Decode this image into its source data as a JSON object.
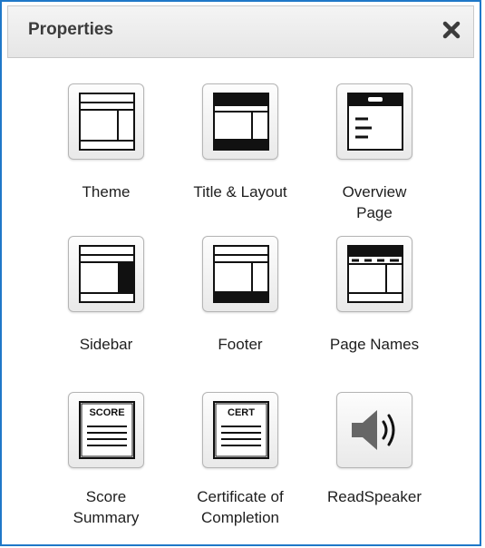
{
  "panel": {
    "title": "Properties",
    "close_icon": "close-icon"
  },
  "tiles": [
    {
      "label": "Theme",
      "icon": "theme-icon"
    },
    {
      "label": "Title & Layout",
      "icon": "title-layout-icon"
    },
    {
      "label": "Overview\nPage",
      "icon": "overview-page-icon"
    },
    {
      "label": "Sidebar",
      "icon": "sidebar-icon"
    },
    {
      "label": "Footer",
      "icon": "footer-icon"
    },
    {
      "label": "Page Names",
      "icon": "page-names-icon"
    },
    {
      "label": "Score\nSummary",
      "icon": "score-summary-icon",
      "badge": "SCORE"
    },
    {
      "label": "Certificate of\nCompletion",
      "icon": "certificate-icon",
      "badge": "CERT"
    },
    {
      "label": "ReadSpeaker",
      "icon": "speaker-icon"
    }
  ],
  "colors": {
    "border": "#1f78c8",
    "icon": "#111111"
  }
}
